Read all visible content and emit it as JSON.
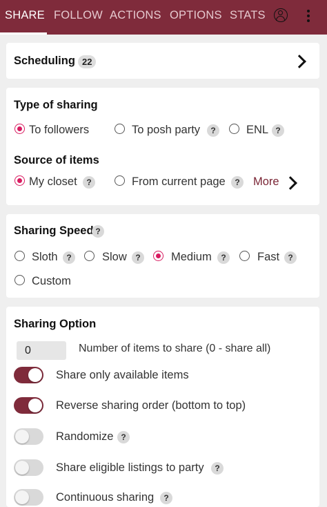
{
  "colors": {
    "brand": "#7f2b3b",
    "accent": "#d81b60"
  },
  "tabs": [
    {
      "label": "SHARE",
      "active": true
    },
    {
      "label": "FOLLOW"
    },
    {
      "label": "ACTIONS"
    },
    {
      "label": "OPTIONS"
    },
    {
      "label": "STATS"
    }
  ],
  "header_icons": [
    "user-icon",
    "more-vertical-icon"
  ],
  "scheduling": {
    "title": "Scheduling",
    "count": "22"
  },
  "type_of_sharing": {
    "title": "Type of sharing",
    "options": [
      {
        "label": "To followers",
        "selected": true
      },
      {
        "label": "To posh party",
        "help": "?"
      },
      {
        "label": "ENL",
        "help": "?"
      }
    ]
  },
  "source_of_items": {
    "title": "Source of items",
    "options": [
      {
        "label": "My closet",
        "selected": true,
        "help": "?"
      },
      {
        "label": "From current page",
        "help": "?"
      }
    ],
    "more_label": "More"
  },
  "sharing_speed": {
    "title": "Sharing Speed",
    "help": "?",
    "options": [
      {
        "label": "Sloth",
        "help": "?"
      },
      {
        "label": "Slow",
        "help": "?"
      },
      {
        "label": "Medium",
        "selected": true,
        "help": "?"
      },
      {
        "label": "Fast",
        "help": "?"
      },
      {
        "label": "Custom"
      }
    ]
  },
  "sharing_option": {
    "title": "Sharing Option",
    "items_count": {
      "value": "0",
      "label": "Number of items to share (0 - share all)"
    },
    "toggles": [
      {
        "label": "Share only available items",
        "on": true
      },
      {
        "label": "Reverse sharing order (bottom to top)",
        "on": true
      },
      {
        "label": "Randomize",
        "on": false,
        "help": "?"
      },
      {
        "label": "Share eligible listings to party",
        "on": false,
        "help": "?"
      },
      {
        "label": "Continuous sharing",
        "on": false,
        "help": "?"
      }
    ]
  }
}
